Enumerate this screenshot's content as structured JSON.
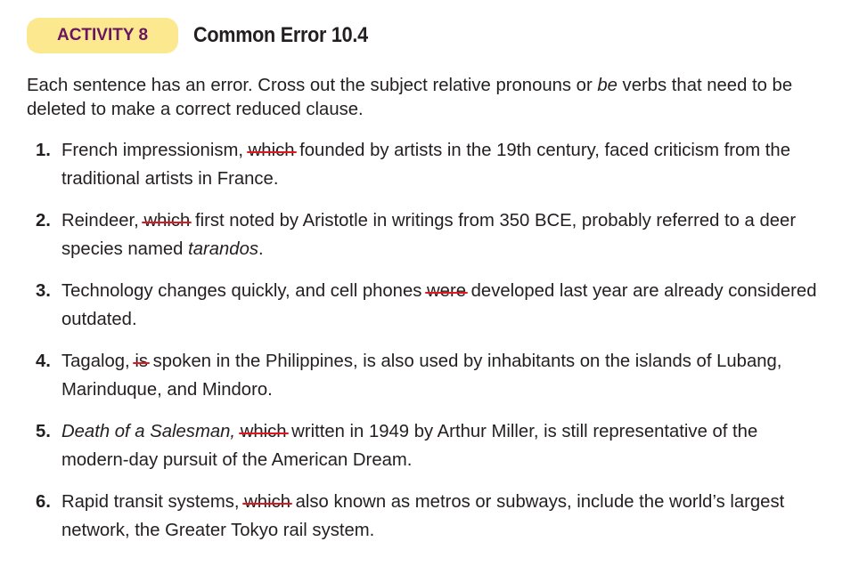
{
  "header": {
    "badge": "ACTIVITY 8",
    "title": "Common Error 10.4",
    "badge_color": "#fbe88f",
    "badge_text_color": "#6a1560"
  },
  "intro": {
    "before": "Each sentence has an error. Cross out the subject relative pronouns or ",
    "italic": "be",
    "after": " verbs that need to be deleted to make a correct reduced clause."
  },
  "strike_color": "#e3161b",
  "items": [
    {
      "num": "1.",
      "parts": [
        {
          "t": "French impressionism, "
        },
        {
          "t": "which",
          "s": true
        },
        {
          "t": " founded by artists in the 19th century, faced criticism from the traditional artists in France."
        }
      ]
    },
    {
      "num": "2.",
      "parts": [
        {
          "t": "Reindeer, "
        },
        {
          "t": "which",
          "s": true
        },
        {
          "t": " first noted by Aristotle in writings from 350 BCE, probably referred to a deer species named "
        },
        {
          "t": "tarandos",
          "i": true
        },
        {
          "t": "."
        }
      ]
    },
    {
      "num": "3.",
      "parts": [
        {
          "t": "Technology changes quickly, and cell phones "
        },
        {
          "t": "were",
          "s": true
        },
        {
          "t": " developed last year are already considered outdated."
        }
      ]
    },
    {
      "num": "4.",
      "parts": [
        {
          "t": "Tagalog, "
        },
        {
          "t": "is",
          "s": true
        },
        {
          "t": " spoken in the Philippines, is also used by inhabitants on the islands of Lubang, Marinduque, and Mindoro."
        }
      ]
    },
    {
      "num": "5.",
      "parts": [
        {
          "t": "Death of a Salesman,",
          "i": true
        },
        {
          "t": " "
        },
        {
          "t": "which",
          "s": true
        },
        {
          "t": " written in 1949 by Arthur Miller, is still representative of the modern-day pursuit of the American Dream."
        }
      ]
    },
    {
      "num": "6.",
      "parts": [
        {
          "t": "Rapid transit systems, "
        },
        {
          "t": "which",
          "s": true
        },
        {
          "t": " also known as metros or subways, include the world’s largest network, the Greater Tokyo rail system."
        }
      ]
    }
  ]
}
